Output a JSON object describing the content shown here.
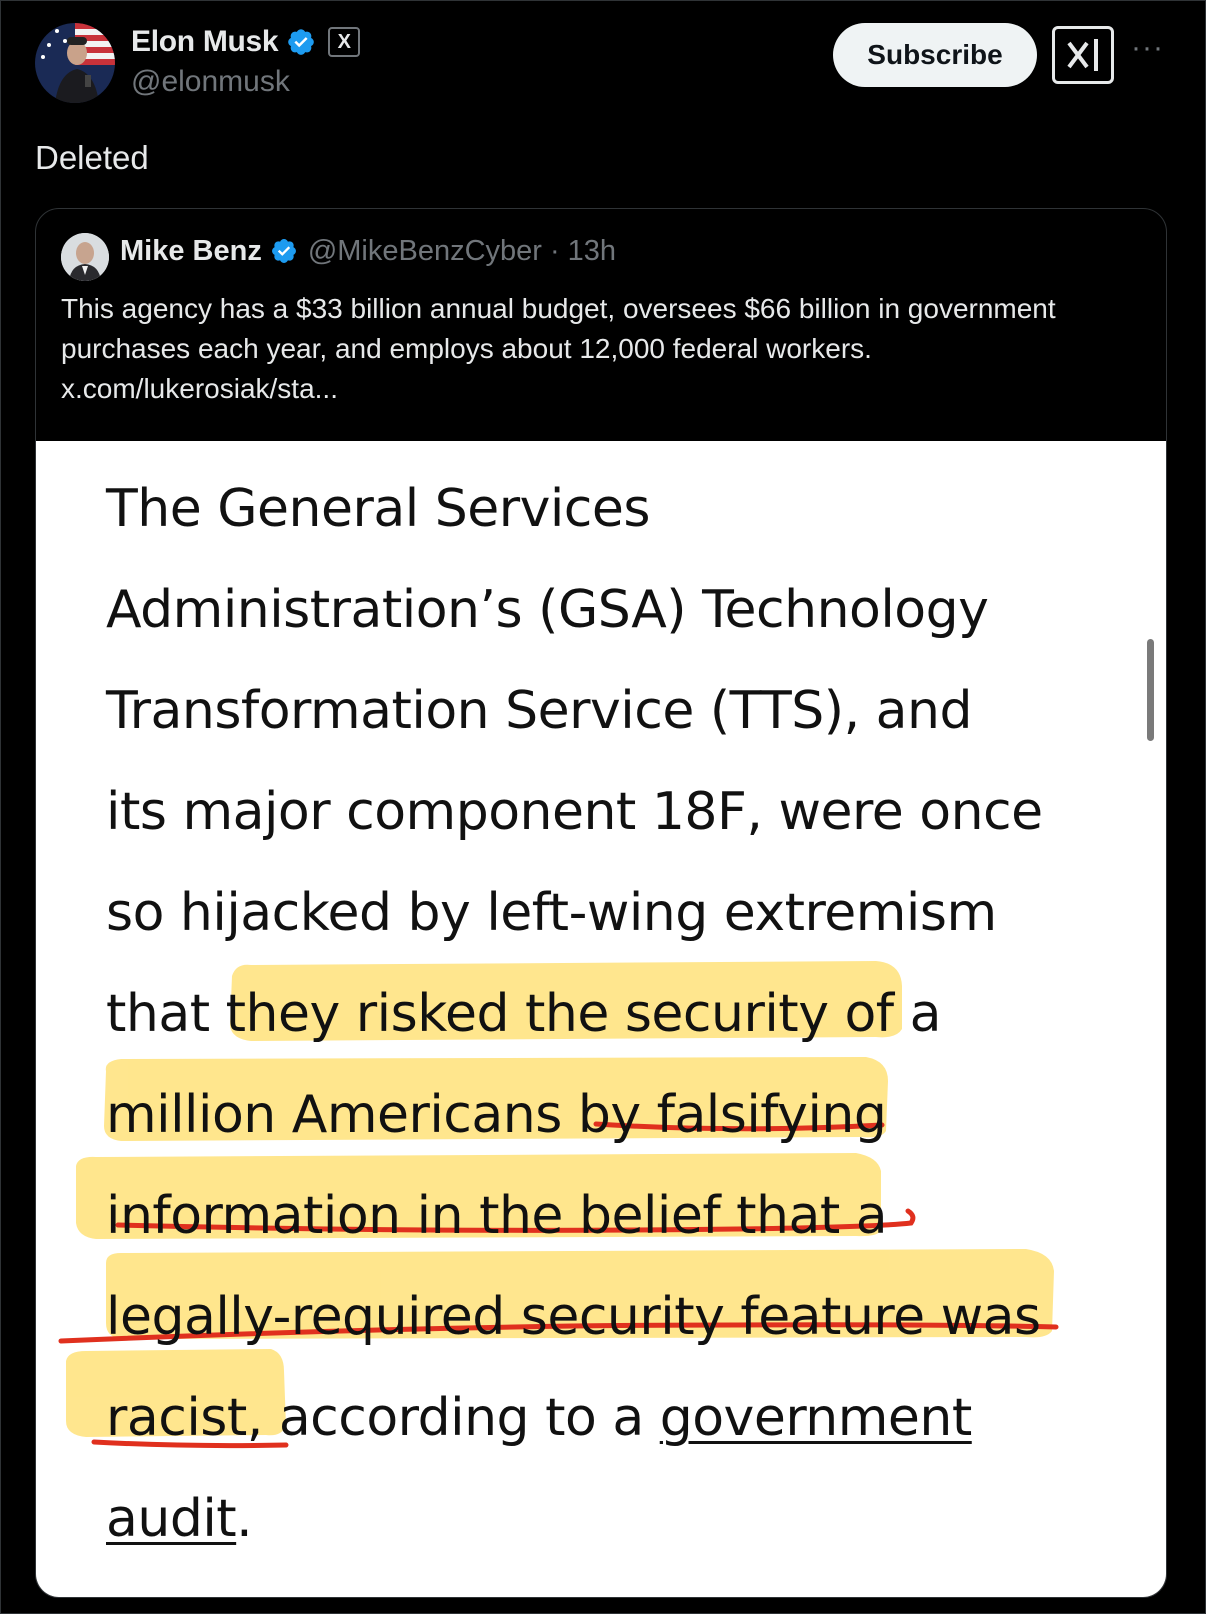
{
  "author": {
    "name": "Elon Musk",
    "handle": "@elonmusk",
    "badge": "X"
  },
  "actions": {
    "subscribe_label": "Subscribe",
    "more_label": "···"
  },
  "post": {
    "text": "Deleted"
  },
  "quote": {
    "name": "Mike Benz",
    "handle": "@MikeBenzCyber",
    "separator": "·",
    "time": "13h",
    "text": "This agency has a $33 billion annual budget, oversees $66 billion in government purchases each year, and employs about 12,000 federal workers. x.com/lukerosiak/sta..."
  },
  "article_image": {
    "lines": [
      "The General Services",
      "Administration’s (GSA) Technology",
      "Transformation Service (TTS), and",
      "its major component 18F, were once",
      "so hijacked by left-wing extremism",
      "that they risked the security of a",
      "million Americans by falsifying",
      "information in the belief that a",
      "legally-required security feature was"
    ],
    "last_line_prefix": "racist, according to a ",
    "link_text_1": "government",
    "link_text_2": "audit",
    "end_punct": ".",
    "highlight_color": "#ffe27a",
    "underline_color": "#e0301e"
  },
  "colors": {
    "verified": "#1d9bf0",
    "background": "#000000",
    "muted": "#71767b"
  }
}
